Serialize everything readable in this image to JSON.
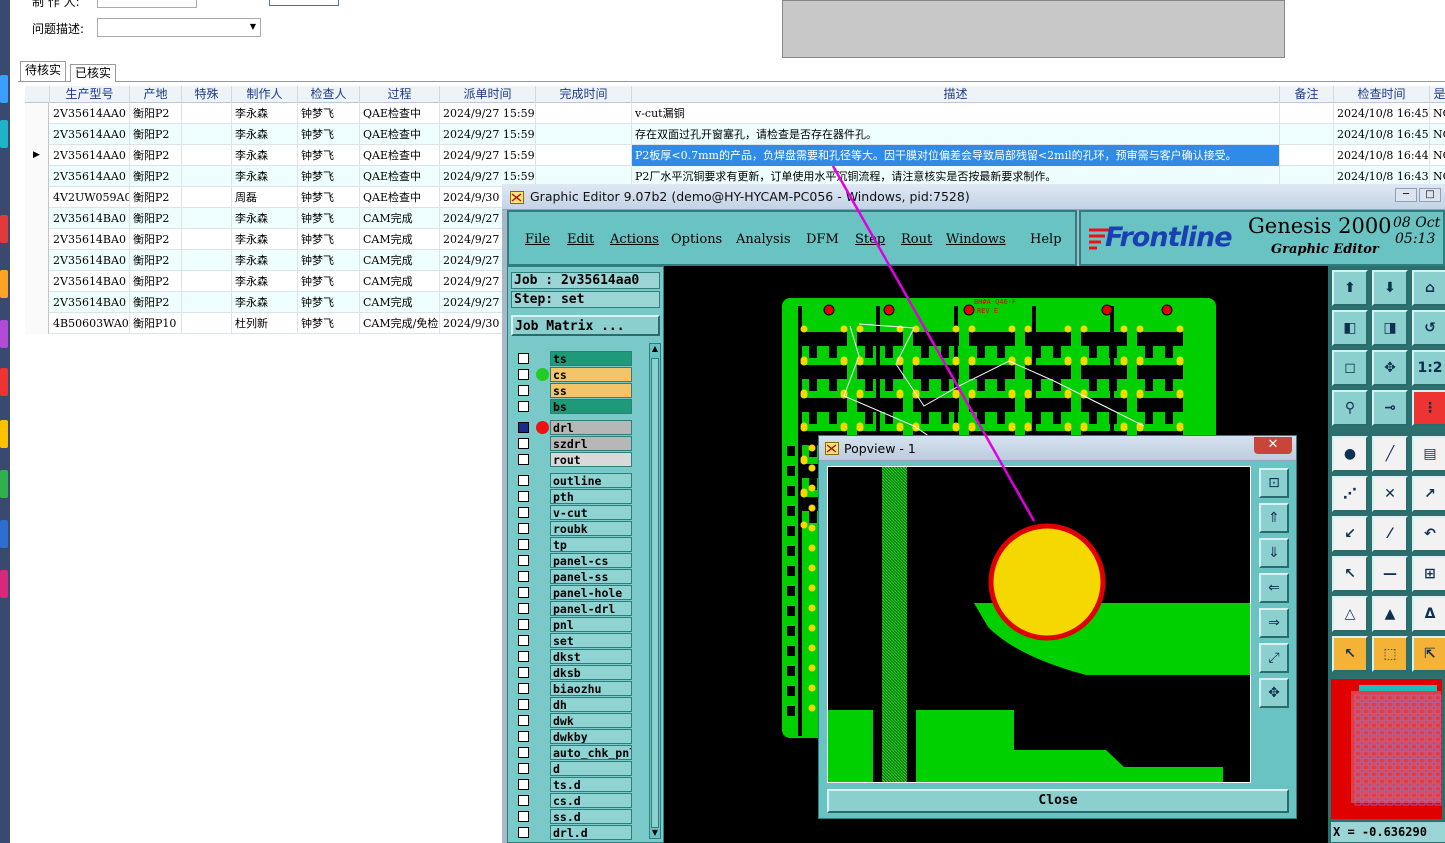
{
  "form": {
    "maker_label": "制 作 人:",
    "issue_label": "问题描述:"
  },
  "tabs": [
    {
      "label": "待核实"
    },
    {
      "label": "已核实"
    }
  ],
  "grid": {
    "headers": [
      "生产型号",
      "产地",
      "特殊",
      "制作人",
      "检查人",
      "过程",
      "派单时间",
      "完成时间",
      "描述",
      "备注",
      "检查时间",
      "是"
    ],
    "rows": [
      {
        "model": "2V35614AA0",
        "site": "衡阳P2",
        "special": "",
        "maker": "李永森",
        "checker": "钟梦飞",
        "process": "QAE检查中",
        "dispatch": "2024/9/27 15:59",
        "done": "",
        "desc": "v-cut漏铜",
        "note": "",
        "check_time": "2024/10/8 16:45",
        "res": "NG"
      },
      {
        "model": "2V35614AA0",
        "site": "衡阳P2",
        "special": "",
        "maker": "李永森",
        "checker": "钟梦飞",
        "process": "QAE检查中",
        "dispatch": "2024/9/27 15:59",
        "done": "",
        "desc": "存在双面过孔开窗塞孔，请检查是否存在器件孔。",
        "note": "",
        "check_time": "2024/10/8 16:45",
        "res": "NG"
      },
      {
        "model": "2V35614AA0",
        "site": "衡阳P2",
        "special": "",
        "maker": "李永森",
        "checker": "钟梦飞",
        "process": "QAE检查中",
        "dispatch": "2024/9/27 15:59",
        "done": "",
        "desc": "P2板厚<0.7mm的产品，负焊盘需要和孔径等大。因干膜对位偏差会导致局部残留<2mil的孔环，预审需与客户确认接受。",
        "note": "",
        "check_time": "2024/10/8 16:44",
        "res": "NG"
      },
      {
        "model": "2V35614AA0",
        "site": "衡阳P2",
        "special": "",
        "maker": "李永森",
        "checker": "钟梦飞",
        "process": "QAE检查中",
        "dispatch": "2024/9/27 15:59",
        "done": "",
        "desc": "P2厂水平沉铜要求有更新，订单使用水平沉铜流程，请注意核实是否按最新要求制作。",
        "note": "",
        "check_time": "2024/10/8 16:43",
        "res": "NG"
      },
      {
        "model": "4V2UW059A0",
        "site": "衡阳P2",
        "special": "",
        "maker": "周磊",
        "checker": "钟梦飞",
        "process": "QAE检查中",
        "dispatch": "2024/9/30",
        "done": "",
        "desc": "",
        "note": "",
        "check_time": "",
        "res": ""
      },
      {
        "model": "2V35614BA0",
        "site": "衡阳P2",
        "special": "",
        "maker": "李永森",
        "checker": "钟梦飞",
        "process": "CAM完成",
        "dispatch": "2024/9/27",
        "done": "",
        "desc": "",
        "note": "",
        "check_time": "",
        "res": ""
      },
      {
        "model": "2V35614BA0",
        "site": "衡阳P2",
        "special": "",
        "maker": "李永森",
        "checker": "钟梦飞",
        "process": "CAM完成",
        "dispatch": "2024/9/27",
        "done": "",
        "desc": "",
        "note": "",
        "check_time": "",
        "res": ""
      },
      {
        "model": "2V35614BA0",
        "site": "衡阳P2",
        "special": "",
        "maker": "李永森",
        "checker": "钟梦飞",
        "process": "CAM完成",
        "dispatch": "2024/9/27",
        "done": "",
        "desc": "",
        "note": "",
        "check_time": "",
        "res": ""
      },
      {
        "model": "2V35614BA0",
        "site": "衡阳P2",
        "special": "",
        "maker": "李永森",
        "checker": "钟梦飞",
        "process": "CAM完成",
        "dispatch": "2024/9/27",
        "done": "",
        "desc": "",
        "note": "",
        "check_time": "",
        "res": ""
      },
      {
        "model": "2V35614BA0",
        "site": "衡阳P2",
        "special": "",
        "maker": "李永森",
        "checker": "钟梦飞",
        "process": "CAM完成",
        "dispatch": "2024/9/27",
        "done": "",
        "desc": "",
        "note": "",
        "check_time": "",
        "res": ""
      },
      {
        "model": "4B50603WA0",
        "site": "衡阳P10",
        "special": "",
        "maker": "杜列新",
        "checker": "钟梦飞",
        "process": "CAM完成/免检",
        "dispatch": "2024/9/30",
        "done": "",
        "desc": "",
        "note": "",
        "check_time": "",
        "res": ""
      }
    ]
  },
  "genesis": {
    "title": "Graphic Editor 9.07b2 (demo@HY-HYCAM-PC056 - Windows, pid:7528)",
    "menus": [
      "File",
      "Edit",
      "Actions",
      "Options",
      "Analysis",
      "DFM",
      "Step",
      "Rout",
      "Windows",
      "Help"
    ],
    "logo": "Frontline",
    "product": "Genesis 2000",
    "subtitle": "Graphic Editor",
    "date": "08 Oct",
    "time": "05:13",
    "job": "Job : 2v35614aa0",
    "step": "Step: set",
    "job_matrix": "Job Matrix ...",
    "layers": [
      {
        "name": "ts",
        "color": "#1f9a78"
      },
      {
        "name": "cs",
        "color": "#f4c46a"
      },
      {
        "name": "ss",
        "color": "#f4c46a"
      },
      {
        "name": "bs",
        "color": "#1f9a78"
      },
      {
        "name": "drl",
        "color": "#b7b7b7"
      },
      {
        "name": "szdrl",
        "color": "#b7b7b7"
      },
      {
        "name": "rout",
        "color": "#d9d9d9"
      },
      {
        "name": "outline",
        "color": "#8fd3d3"
      },
      {
        "name": "pth",
        "color": "#8fd3d3"
      },
      {
        "name": "v-cut",
        "color": "#8fd3d3"
      },
      {
        "name": "roubk",
        "color": "#8fd3d3"
      },
      {
        "name": "tp",
        "color": "#8fd3d3"
      },
      {
        "name": "panel-cs",
        "color": "#8fd3d3"
      },
      {
        "name": "panel-ss",
        "color": "#8fd3d3"
      },
      {
        "name": "panel-hole",
        "color": "#8fd3d3"
      },
      {
        "name": "panel-drl",
        "color": "#8fd3d3"
      },
      {
        "name": "pnl",
        "color": "#8fd3d3"
      },
      {
        "name": "set",
        "color": "#8fd3d3"
      },
      {
        "name": "dkst",
        "color": "#8fd3d3"
      },
      {
        "name": "dksb",
        "color": "#8fd3d3"
      },
      {
        "name": "biaozhu",
        "color": "#8fd3d3"
      },
      {
        "name": "dh",
        "color": "#8fd3d3"
      },
      {
        "name": "dwk",
        "color": "#8fd3d3"
      },
      {
        "name": "dwkby",
        "color": "#8fd3d3"
      },
      {
        "name": "auto_chk_pnl",
        "color": "#8fd3d3"
      },
      {
        "name": "d",
        "color": "#8fd3d3"
      },
      {
        "name": "ts.d",
        "color": "#8fd3d3"
      },
      {
        "name": "cs.d",
        "color": "#8fd3d3"
      },
      {
        "name": "ss.d",
        "color": "#8fd3d3"
      },
      {
        "name": "drl.d",
        "color": "#8fd3d3"
      }
    ],
    "board_label": "BH#A-Q46-F\nREV E",
    "coord": "X = -0.636290",
    "ratio_label": "1:2"
  },
  "popview": {
    "title": "Popview - 1",
    "close": "Close"
  },
  "colors": {
    "pcb_green": "#00d000",
    "pad_yellow": "#f5d800",
    "pad_red": "#e00000",
    "selection_blue": "#2f8be6",
    "genesis_teal": "#69c3c3",
    "magenta_line": "#e000e0"
  }
}
